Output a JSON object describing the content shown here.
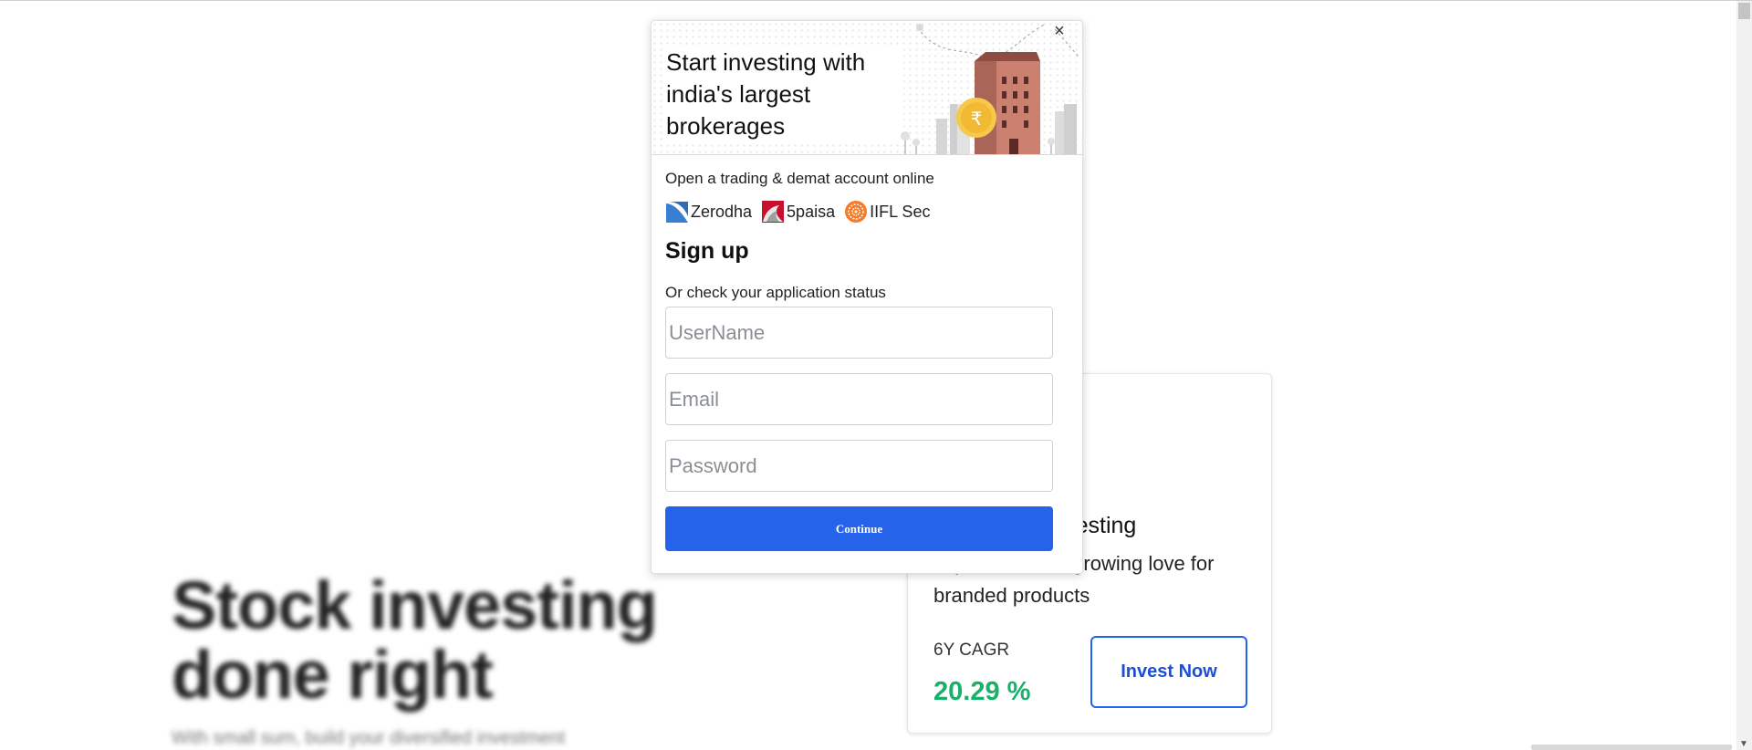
{
  "hero": {
    "title": "Stock investing done right",
    "subtitle": "With small sum, build your diversified investment"
  },
  "card": {
    "title": "Consumer Investing",
    "description": "Tap into India's growing love for branded products",
    "cagr_label": "6Y CAGR",
    "cagr_value": "20.29 %",
    "invest_button": "Invest Now",
    "colors": {
      "cagr": "#17b26a",
      "accent": "#2563eb"
    }
  },
  "modal": {
    "title": "Start investing with india's largest brokerages",
    "close_icon": "close-icon",
    "subtitle": "Open a trading & demat account online",
    "brokers": [
      {
        "name": "Zerodha",
        "icon": "zerodha-logo-icon"
      },
      {
        "name": "5paisa",
        "icon": "5paisa-logo-icon"
      },
      {
        "name": "IIFL Sec",
        "icon": "iifl-logo-icon"
      }
    ],
    "signup_heading": "Sign up",
    "status_text": "Or check your application status",
    "fields": {
      "username_placeholder": "UserName",
      "email_placeholder": "Email",
      "password_placeholder": "Password"
    },
    "continue_label": "Continue",
    "colors": {
      "button": "#2563eb"
    }
  }
}
